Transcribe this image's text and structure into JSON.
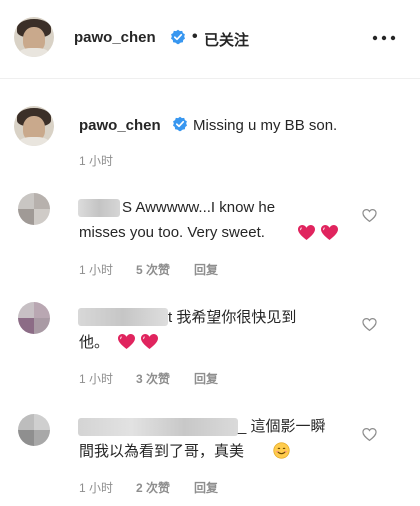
{
  "header": {
    "username": "pawo_chen",
    "separator": "•",
    "follow_status": "已关注",
    "more_icon": "more-horizontal-icon"
  },
  "caption": {
    "username": "pawo_chen",
    "text": "Missing u my BB son.",
    "time": "1 小时"
  },
  "comments": [
    {
      "text_line1": "S Awwwww...I know he",
      "text_line2": "misses you too. Very sweet.",
      "time": "1 小时",
      "likes": "5 次赞",
      "reply": "回复"
    },
    {
      "text_line1": "t 我希望你很快见到",
      "text_line2": "他。",
      "time": "1 小时",
      "likes": "3 次赞",
      "reply": "回复"
    },
    {
      "text_line1": "_ 這個影一瞬",
      "text_line2": "間我以為看到了哥，真美",
      "time": "1 小时",
      "likes": "2 次赞",
      "reply": "回复"
    }
  ],
  "colors": {
    "verified": "#3897f0",
    "heart_red": "#e0245e",
    "meta_gray": "#8e8e8e",
    "text": "#262626"
  }
}
